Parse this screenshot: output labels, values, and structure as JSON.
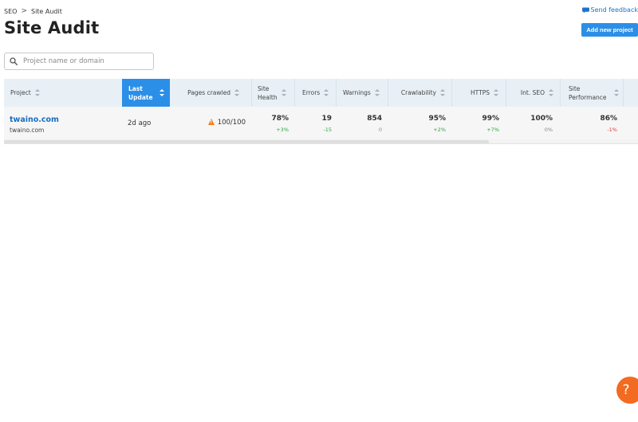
{
  "breadcrumb": {
    "parent": "SEO",
    "separator": ">",
    "current": "Site Audit"
  },
  "page_title": "Site Audit",
  "feedback": {
    "label": "Send feedback",
    "icon": "chat-icon"
  },
  "add_project": {
    "label": "Add new project",
    "color": "#2b8fe8"
  },
  "search": {
    "placeholder": "Project name or domain",
    "value": ""
  },
  "table": {
    "headers": {
      "project": "Project",
      "last_update": "Last Update",
      "pages_crawled": "Pages crawled",
      "site_health": "Site Health",
      "errors": "Errors",
      "warnings": "Warnings",
      "crawlability": "Crawlability",
      "https": "HTTPS",
      "int_seo": "Int. SEO",
      "site_performance": "Site Performance"
    },
    "active_sort": "last_update",
    "rows": [
      {
        "project_name": "twaino.com",
        "project_domain": "twaino.com",
        "last_update": "2d ago",
        "pages_crawled": "100/100",
        "site_health": {
          "value": "78%",
          "delta": "+3%"
        },
        "errors": {
          "value": "19",
          "delta": "-15"
        },
        "warnings": {
          "value": "854",
          "delta": "0"
        },
        "crawlability": {
          "value": "95%",
          "delta": "+2%"
        },
        "https": {
          "value": "99%",
          "delta": "+7%"
        },
        "int_seo": {
          "value": "100%",
          "delta": "0%"
        },
        "site_performance": {
          "value": "86%",
          "delta": "-1%"
        }
      }
    ]
  },
  "help": {
    "label": "?",
    "color": "#f26b21"
  },
  "colors": {
    "positive": "#2ba43c",
    "negative": "#e53935",
    "warning": "#f07c1c",
    "link": "#1a6ec2"
  }
}
